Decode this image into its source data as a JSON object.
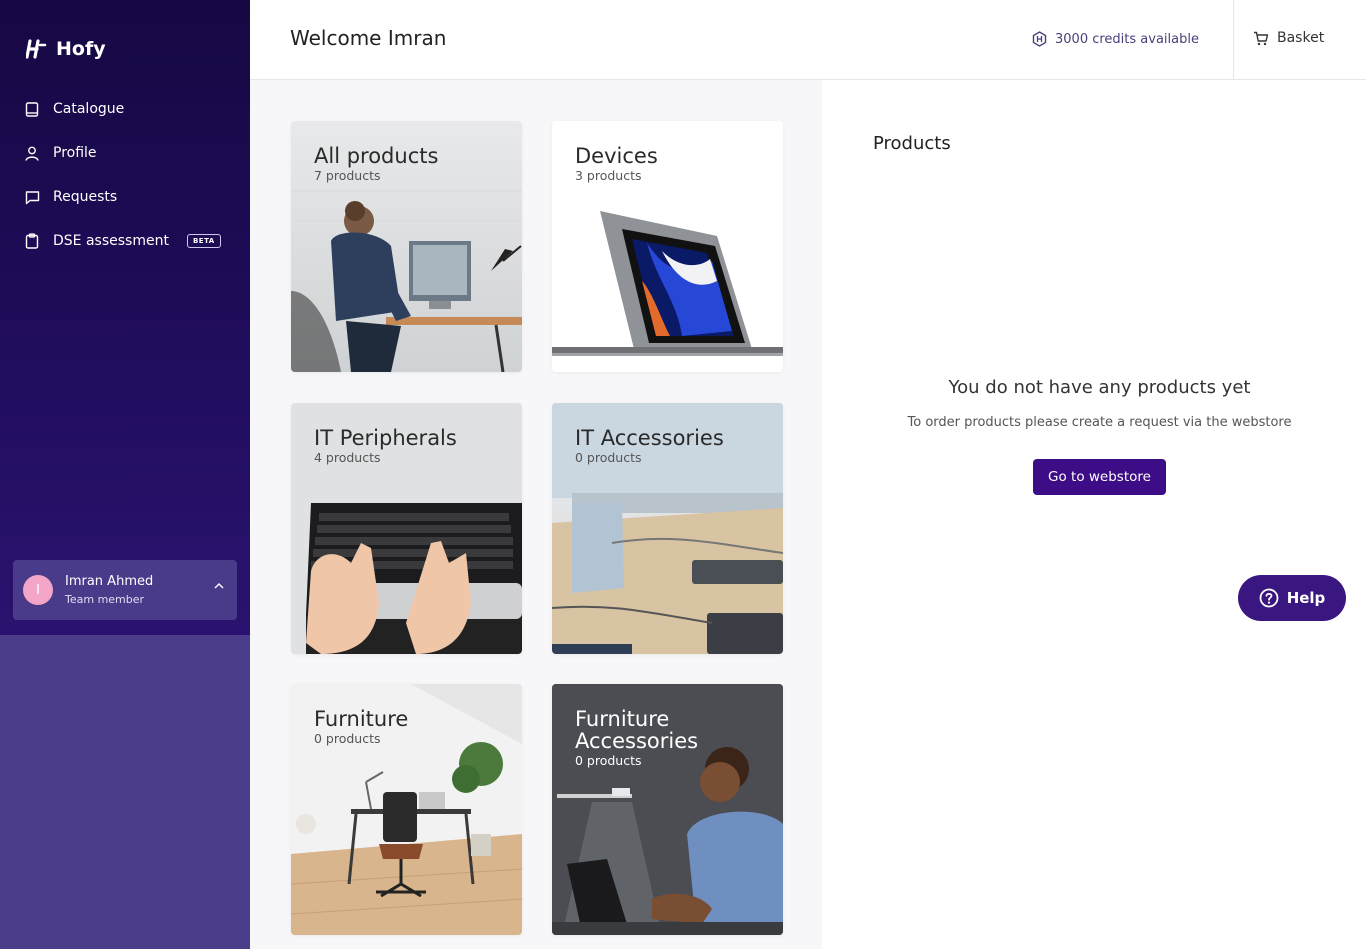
{
  "app": {
    "name": "Hofy"
  },
  "sidebar": {
    "items": [
      {
        "label": "Catalogue",
        "icon": "book-icon"
      },
      {
        "label": "Profile",
        "icon": "user-icon"
      },
      {
        "label": "Requests",
        "icon": "chat-icon"
      },
      {
        "label": "DSE assessment",
        "icon": "clipboard-icon",
        "badge": "BETA"
      }
    ],
    "user": {
      "initial": "I",
      "name": "Imran Ahmed",
      "role": "Team member"
    }
  },
  "header": {
    "welcome": "Welcome Imran",
    "credits": "3000 credits available",
    "basket": "Basket"
  },
  "categories": [
    {
      "title": "All products",
      "count": "7 products"
    },
    {
      "title": "Devices",
      "count": "3 products"
    },
    {
      "title": "IT Peripherals",
      "count": "4 products"
    },
    {
      "title": "IT Accessories",
      "count": "0 products"
    },
    {
      "title": "Furniture",
      "count": "0 products"
    },
    {
      "title": "Furniture Accessories",
      "count": "0 products"
    }
  ],
  "panel": {
    "title": "Products",
    "empty_title": "You do not have any products yet",
    "empty_sub": "To order products please create a request via the webstore",
    "button": "Go to webstore"
  },
  "help": {
    "label": "Help"
  },
  "colors": {
    "sidebar": "#1d0b55",
    "accent": "#3d0c87",
    "help": "#3a1681"
  }
}
